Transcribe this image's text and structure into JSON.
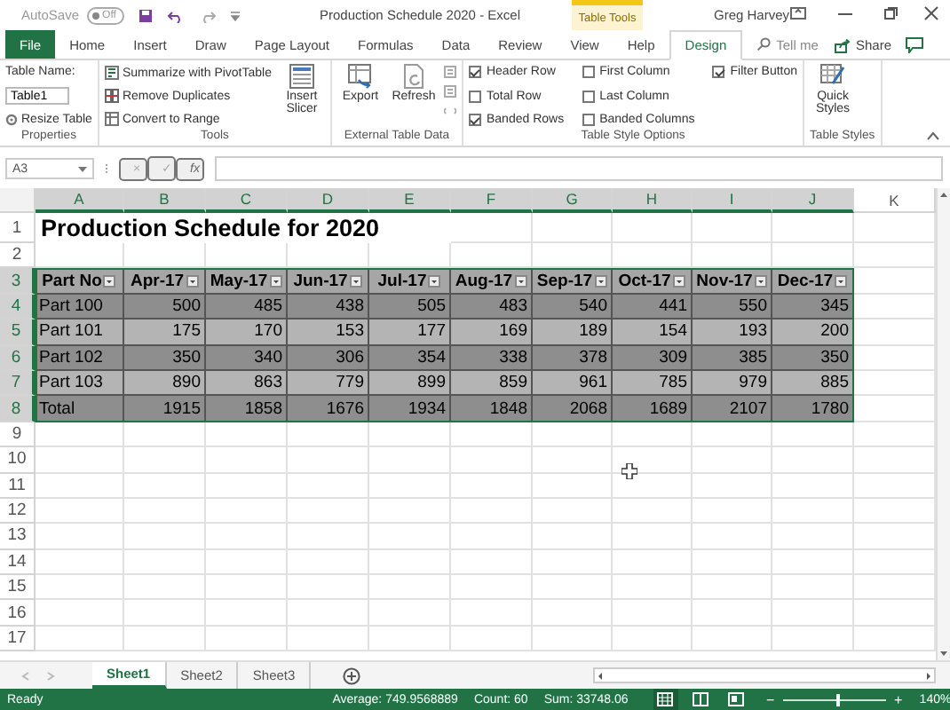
{
  "window": {
    "autosave_label": "AutoSave",
    "autosave_state": "Off",
    "title": "Production Schedule 2020  -  Excel",
    "context_label": "Table Tools",
    "user": "Greg Harvey"
  },
  "tabs": [
    {
      "label": "File",
      "kind": "file",
      "selected": false
    },
    {
      "label": "Home",
      "kind": "tab",
      "selected": false
    },
    {
      "label": "Insert",
      "kind": "tab",
      "selected": false
    },
    {
      "label": "Draw",
      "kind": "tab",
      "selected": false
    },
    {
      "label": "Page Layout",
      "kind": "tab",
      "selected": false
    },
    {
      "label": "Formulas",
      "kind": "tab",
      "selected": false
    },
    {
      "label": "Data",
      "kind": "tab",
      "selected": false
    },
    {
      "label": "Review",
      "kind": "tab",
      "selected": false
    },
    {
      "label": "View",
      "kind": "tab",
      "selected": false
    },
    {
      "label": "Help",
      "kind": "tab",
      "selected": false
    },
    {
      "label": "Design",
      "kind": "tab",
      "selected": true
    }
  ],
  "tell_me": {
    "placeholder": "Tell me"
  },
  "share": "Share",
  "ribbon": {
    "properties": {
      "name_label": "Table Name:",
      "name_value": "Table1",
      "resize": "Resize Table",
      "label": "Properties"
    },
    "tools": {
      "items": [
        "Summarize with PivotTable",
        "Remove Duplicates",
        "Convert to Range"
      ],
      "slicer": "Insert Slicer",
      "label": "Tools"
    },
    "external": {
      "export": "Export",
      "refresh": "Refresh",
      "label": "External Table Data"
    },
    "style_options": {
      "options": [
        {
          "label": "Header Row",
          "checked": true
        },
        {
          "label": "Total Row",
          "checked": false
        },
        {
          "label": "Banded Rows",
          "checked": true
        },
        {
          "label": "First Column",
          "checked": false
        },
        {
          "label": "Last Column",
          "checked": false
        },
        {
          "label": "Banded Columns",
          "checked": false
        },
        {
          "label": "Filter Button",
          "checked": true
        }
      ],
      "label": "Table Style Options"
    },
    "styles": {
      "quick": "Quick Styles",
      "label": "Table Styles"
    }
  },
  "formula_bar": {
    "name_box": "A3",
    "buttons": [
      "×",
      "✓",
      "fx"
    ]
  },
  "sheet": {
    "columns": [
      {
        "letter": "A",
        "selected": true
      },
      {
        "letter": "B",
        "selected": true
      },
      {
        "letter": "C",
        "selected": true
      },
      {
        "letter": "D",
        "selected": true
      },
      {
        "letter": "E",
        "selected": true
      },
      {
        "letter": "F",
        "selected": true
      },
      {
        "letter": "G",
        "selected": true
      },
      {
        "letter": "H",
        "selected": true
      },
      {
        "letter": "I",
        "selected": true
      },
      {
        "letter": "J",
        "selected": true
      },
      {
        "letter": "K",
        "selected": false
      }
    ],
    "rows": [
      {
        "number": "1",
        "selected": false
      },
      {
        "number": "2",
        "selected": false
      },
      {
        "number": "3",
        "selected": true
      },
      {
        "number": "4",
        "selected": true
      },
      {
        "number": "5",
        "selected": true
      },
      {
        "number": "6",
        "selected": true
      },
      {
        "number": "7",
        "selected": true
      },
      {
        "number": "8",
        "selected": true
      },
      {
        "number": "9",
        "selected": false
      },
      {
        "number": "10",
        "selected": false
      },
      {
        "number": "11",
        "selected": false
      },
      {
        "number": "12",
        "selected": false
      },
      {
        "number": "13",
        "selected": false
      },
      {
        "number": "14",
        "selected": false
      },
      {
        "number": "15",
        "selected": false
      },
      {
        "number": "16",
        "selected": false
      },
      {
        "number": "17",
        "selected": false
      }
    ],
    "title": "Production Schedule for 2020",
    "table": {
      "headers": [
        "Part No",
        "Apr-17",
        "May-17",
        "Jun-17",
        "Jul-17",
        "Aug-17",
        "Sep-17",
        "Oct-17",
        "Nov-17",
        "Dec-17"
      ],
      "rows": [
        [
          "Part 100",
          "500",
          "485",
          "438",
          "505",
          "483",
          "540",
          "441",
          "550",
          "345"
        ],
        [
          "Part 101",
          "175",
          "170",
          "153",
          "177",
          "169",
          "189",
          "154",
          "193",
          "200"
        ],
        [
          "Part 102",
          "350",
          "340",
          "306",
          "354",
          "338",
          "378",
          "309",
          "385",
          "350"
        ],
        [
          "Part 103",
          "890",
          "863",
          "779",
          "899",
          "859",
          "961",
          "785",
          "979",
          "885"
        ],
        [
          "Total",
          "1915",
          "1858",
          "1676",
          "1934",
          "1848",
          "2068",
          "1689",
          "2107",
          "1780"
        ]
      ]
    }
  },
  "sheet_tabs": [
    {
      "label": "Sheet1",
      "selected": true
    },
    {
      "label": "Sheet2",
      "selected": false
    },
    {
      "label": "Sheet3",
      "selected": false
    }
  ],
  "status_bar": {
    "mode": "Ready",
    "average": "Average: 749.9568889",
    "count": "Count: 60",
    "sum": "Sum: 33748.06",
    "views": [
      {
        "kind": "normal",
        "selected": true
      },
      {
        "kind": "page-layout",
        "selected": false
      },
      {
        "kind": "page-break",
        "selected": false
      }
    ],
    "zoom": {
      "zoom_out": "−",
      "zoom_in": "+",
      "level": 0.52,
      "reading": "140%"
    }
  }
}
